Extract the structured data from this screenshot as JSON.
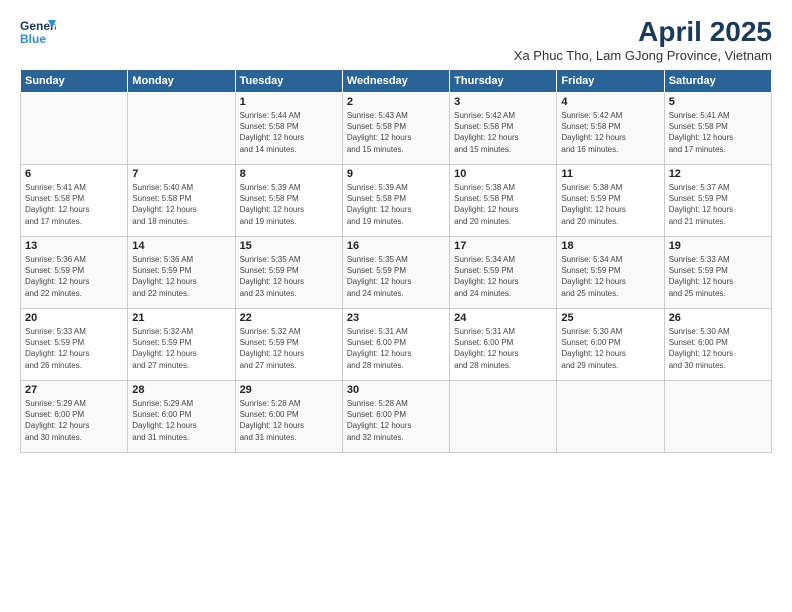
{
  "logo": {
    "line1": "General",
    "line2": "Blue"
  },
  "title": "April 2025",
  "subtitle": "Xa Phuc Tho, Lam GJong Province, Vietnam",
  "headers": [
    "Sunday",
    "Monday",
    "Tuesday",
    "Wednesday",
    "Thursday",
    "Friday",
    "Saturday"
  ],
  "weeks": [
    [
      {
        "day": "",
        "info": ""
      },
      {
        "day": "",
        "info": ""
      },
      {
        "day": "1",
        "info": "Sunrise: 5:44 AM\nSunset: 5:58 PM\nDaylight: 12 hours\nand 14 minutes."
      },
      {
        "day": "2",
        "info": "Sunrise: 5:43 AM\nSunset: 5:58 PM\nDaylight: 12 hours\nand 15 minutes."
      },
      {
        "day": "3",
        "info": "Sunrise: 5:42 AM\nSunset: 5:58 PM\nDaylight: 12 hours\nand 15 minutes."
      },
      {
        "day": "4",
        "info": "Sunrise: 5:42 AM\nSunset: 5:58 PM\nDaylight: 12 hours\nand 16 minutes."
      },
      {
        "day": "5",
        "info": "Sunrise: 5:41 AM\nSunset: 5:58 PM\nDaylight: 12 hours\nand 17 minutes."
      }
    ],
    [
      {
        "day": "6",
        "info": "Sunrise: 5:41 AM\nSunset: 5:58 PM\nDaylight: 12 hours\nand 17 minutes."
      },
      {
        "day": "7",
        "info": "Sunrise: 5:40 AM\nSunset: 5:58 PM\nDaylight: 12 hours\nand 18 minutes."
      },
      {
        "day": "8",
        "info": "Sunrise: 5:39 AM\nSunset: 5:58 PM\nDaylight: 12 hours\nand 19 minutes."
      },
      {
        "day": "9",
        "info": "Sunrise: 5:39 AM\nSunset: 5:58 PM\nDaylight: 12 hours\nand 19 minutes."
      },
      {
        "day": "10",
        "info": "Sunrise: 5:38 AM\nSunset: 5:58 PM\nDaylight: 12 hours\nand 20 minutes."
      },
      {
        "day": "11",
        "info": "Sunrise: 5:38 AM\nSunset: 5:59 PM\nDaylight: 12 hours\nand 20 minutes."
      },
      {
        "day": "12",
        "info": "Sunrise: 5:37 AM\nSunset: 5:59 PM\nDaylight: 12 hours\nand 21 minutes."
      }
    ],
    [
      {
        "day": "13",
        "info": "Sunrise: 5:36 AM\nSunset: 5:59 PM\nDaylight: 12 hours\nand 22 minutes."
      },
      {
        "day": "14",
        "info": "Sunrise: 5:36 AM\nSunset: 5:59 PM\nDaylight: 12 hours\nand 22 minutes."
      },
      {
        "day": "15",
        "info": "Sunrise: 5:35 AM\nSunset: 5:59 PM\nDaylight: 12 hours\nand 23 minutes."
      },
      {
        "day": "16",
        "info": "Sunrise: 5:35 AM\nSunset: 5:59 PM\nDaylight: 12 hours\nand 24 minutes."
      },
      {
        "day": "17",
        "info": "Sunrise: 5:34 AM\nSunset: 5:59 PM\nDaylight: 12 hours\nand 24 minutes."
      },
      {
        "day": "18",
        "info": "Sunrise: 5:34 AM\nSunset: 5:59 PM\nDaylight: 12 hours\nand 25 minutes."
      },
      {
        "day": "19",
        "info": "Sunrise: 5:33 AM\nSunset: 5:59 PM\nDaylight: 12 hours\nand 25 minutes."
      }
    ],
    [
      {
        "day": "20",
        "info": "Sunrise: 5:33 AM\nSunset: 5:59 PM\nDaylight: 12 hours\nand 26 minutes."
      },
      {
        "day": "21",
        "info": "Sunrise: 5:32 AM\nSunset: 5:59 PM\nDaylight: 12 hours\nand 27 minutes."
      },
      {
        "day": "22",
        "info": "Sunrise: 5:32 AM\nSunset: 5:59 PM\nDaylight: 12 hours\nand 27 minutes."
      },
      {
        "day": "23",
        "info": "Sunrise: 5:31 AM\nSunset: 6:00 PM\nDaylight: 12 hours\nand 28 minutes."
      },
      {
        "day": "24",
        "info": "Sunrise: 5:31 AM\nSunset: 6:00 PM\nDaylight: 12 hours\nand 28 minutes."
      },
      {
        "day": "25",
        "info": "Sunrise: 5:30 AM\nSunset: 6:00 PM\nDaylight: 12 hours\nand 29 minutes."
      },
      {
        "day": "26",
        "info": "Sunrise: 5:30 AM\nSunset: 6:00 PM\nDaylight: 12 hours\nand 30 minutes."
      }
    ],
    [
      {
        "day": "27",
        "info": "Sunrise: 5:29 AM\nSunset: 6:00 PM\nDaylight: 12 hours\nand 30 minutes."
      },
      {
        "day": "28",
        "info": "Sunrise: 5:29 AM\nSunset: 6:00 PM\nDaylight: 12 hours\nand 31 minutes."
      },
      {
        "day": "29",
        "info": "Sunrise: 5:28 AM\nSunset: 6:00 PM\nDaylight: 12 hours\nand 31 minutes."
      },
      {
        "day": "30",
        "info": "Sunrise: 5:28 AM\nSunset: 6:00 PM\nDaylight: 12 hours\nand 32 minutes."
      },
      {
        "day": "",
        "info": ""
      },
      {
        "day": "",
        "info": ""
      },
      {
        "day": "",
        "info": ""
      }
    ]
  ]
}
